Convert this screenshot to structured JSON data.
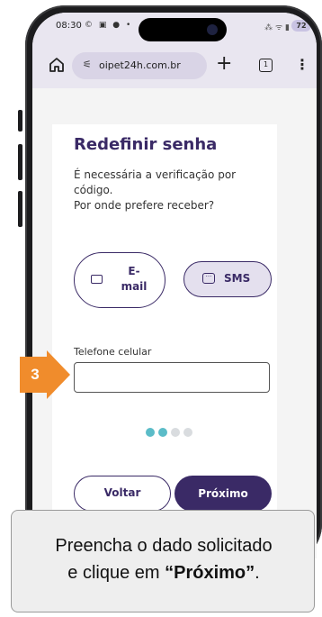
{
  "status_bar": {
    "time": "08:30",
    "left_icons": "© ▣ ● •",
    "right_icons": "⁂ ᯤ ▮",
    "battery": "72"
  },
  "browser": {
    "url": "oipet24h.com.br",
    "tabs_count": "1",
    "plus_label": "+",
    "menu_label": "⋮"
  },
  "form": {
    "title": "Redefinir senha",
    "subtitle_line1": "É necessária a verificação por",
    "subtitle_line2": "código.",
    "subtitle_line3": "Por onde prefere receber?",
    "email_option_line1": "E-",
    "email_option_line2": "mail",
    "sms_option": "SMS",
    "phone_label": "Telefone celular",
    "phone_value": "",
    "back_button": "Voltar",
    "next_button": "Próximo"
  },
  "progress_dots": {
    "total": 4,
    "active_index": 0,
    "active_color": "#5bbcc8",
    "inactive_color": "#d9dcdf"
  },
  "step_marker": {
    "number": "3",
    "color": "#f08c2c"
  },
  "caption": {
    "line1": "Preencha o dado solicitado",
    "line2_prefix": "e clique em ",
    "line2_bold": "“Próximo”",
    "line2_suffix": "."
  },
  "colors": {
    "brand_purple": "#3a2a66",
    "browser_bg": "#e9e6f0"
  },
  "icons": [
    "home-icon",
    "site-settings-icon",
    "plus-icon",
    "tabs-icon",
    "menu-icon",
    "mail-icon",
    "sms-icon"
  ]
}
